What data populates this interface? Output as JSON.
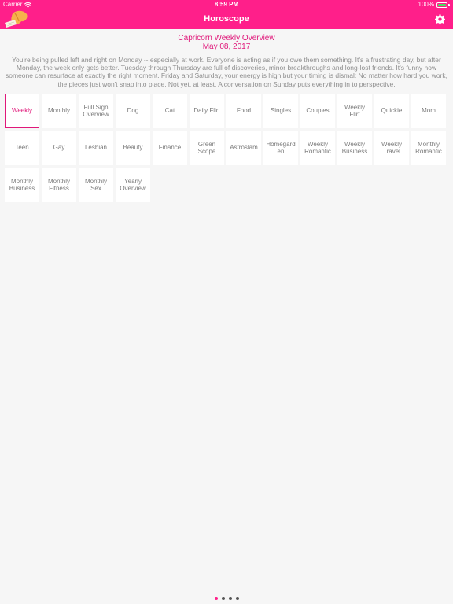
{
  "status_bar": {
    "carrier": "Carrier",
    "time": "8:59 PM",
    "battery": "100%"
  },
  "nav": {
    "title": "Horoscope",
    "logo_icon": "fortune-cookie-icon",
    "settings_icon": "gear-icon"
  },
  "header": {
    "title": "Capricorn Weekly Overview",
    "date": "May 08, 2017"
  },
  "overview_text": "You're being pulled left and right on Monday -- especially at work. Everyone is acting as if you owe them something. It's a frustrating day, but after Monday, the week only gets better. Tuesday through Thursday are full of discoveries, minor breakthroughs and long-lost friends. It's funny how someone can resurface at exactly the right moment. Friday and Saturday, your energy is high but your timing is dismal: No matter how hard you work, the pieces just won't snap into place. Not yet, at least. A conversation on Sunday puts everything in to perspective.",
  "categories": [
    "Weekly",
    "Monthly",
    "Full Sign Overview",
    "Dog",
    "Cat",
    "Daily Flirt",
    "Food",
    "Singles",
    "Couples",
    "Weekly Flirt",
    "Quickie",
    "Mom",
    "Teen",
    "Gay",
    "Lesbian",
    "Beauty",
    "Finance",
    "Green Scope",
    "Astroslam",
    "Homegarden",
    "Weekly Romantic",
    "Weekly Business",
    "Weekly Travel",
    "Monthly Romantic",
    "Monthly Business",
    "Monthly Fitness",
    "Monthly Sex",
    "Yearly Overview"
  ],
  "selected_category": "Weekly",
  "pager": {
    "pages": 4,
    "current": 1
  },
  "colors": {
    "accent": "#ff1f8a",
    "accent_text": "#e0187a",
    "background": "#f6f6f6"
  }
}
